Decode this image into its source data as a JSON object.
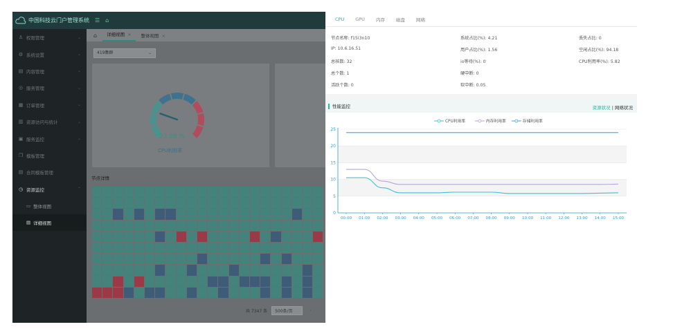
{
  "app": {
    "title": "中国科技云门户管理系统",
    "menu": [
      {
        "label": "权限管理",
        "icon": "user-icon"
      },
      {
        "label": "系统设置",
        "icon": "gear-icon"
      },
      {
        "label": "内容管理",
        "icon": "document-icon"
      },
      {
        "label": "服务管理",
        "icon": "service-icon"
      },
      {
        "label": "订单管理",
        "icon": "order-icon"
      },
      {
        "label": "资源访问与统计",
        "icon": "stats-icon"
      },
      {
        "label": "服务监控",
        "icon": "monitor-icon"
      },
      {
        "label": "模板管理",
        "icon": "template-icon"
      },
      {
        "label": "合同模板管理",
        "icon": "contract-icon"
      },
      {
        "label": "资源监控",
        "icon": "clock-icon"
      }
    ],
    "submenu": [
      {
        "label": "整体视图",
        "icon": "desktop-icon"
      },
      {
        "label": "详细视图",
        "icon": "list-icon"
      }
    ],
    "tabs": [
      {
        "label": "详细视图"
      },
      {
        "label": "整体视图"
      }
    ],
    "cluster_select": "419集群",
    "gauge": {
      "value_text": "23.88 %",
      "label": "CPU利用率",
      "value": 23.88
    },
    "nodes_title": "节点详情",
    "pager": {
      "total": "共 7347 条",
      "page_size": "500条/页"
    }
  },
  "panel": {
    "tabs": [
      "CPU",
      "GPU",
      "内存",
      "磁盘",
      "网络"
    ],
    "info": {
      "node_name": "节点名称: f15i3n10",
      "ip": "IP: 10.6.16.51",
      "total_cores": "总核数: 32",
      "total_count": "总个数: 1",
      "active_count": "活跃个数: 0",
      "sys_ratio": "系统占比(%): 4.21",
      "user_ratio": "用户占比(%): 1.56",
      "io_wait": "io等待(%): 0",
      "hard_irq": "硬中断: 0",
      "soft_irq": "软中断: 0.05",
      "steal_ratio": "丢失占比: 0",
      "idle_ratio": "空闲占比(%): 94.18",
      "cpu_usage": "CPU利用率(%): 5.82"
    },
    "monitor_title": "性能监控",
    "link_resource": "资源状况",
    "link_sep": " | ",
    "link_network": "网络状况"
  },
  "colors": {
    "accent": "#2fb4a4",
    "cpu": "#3cbfd0",
    "mem": "#b8a4d8",
    "disk": "#3fa8c8"
  },
  "chart_data": {
    "type": "line",
    "legend_position": "top-center",
    "x": [
      "00:00",
      "01:00",
      "02:00",
      "03:00",
      "04:00",
      "05:00",
      "06:00",
      "07:00",
      "08:00",
      "09:00",
      "10:00",
      "11:00",
      "12:00",
      "13:00",
      "14:00",
      "15:00"
    ],
    "ylim": [
      0,
      25
    ],
    "yticks": [
      0,
      5,
      10,
      15,
      20,
      25
    ],
    "grid": true,
    "series": [
      {
        "name": "CPU利用率",
        "color": "#3cbfd0",
        "values": [
          10.5,
          10.5,
          7.5,
          6.0,
          6.0,
          6.0,
          6.2,
          6.2,
          6.2,
          5.8,
          5.8,
          5.8,
          5.8,
          5.8,
          5.9,
          6.0
        ]
      },
      {
        "name": "内存利用率",
        "color": "#b8a4d8",
        "values": [
          13.0,
          13.0,
          9.5,
          8.5,
          8.5,
          8.5,
          8.5,
          8.5,
          8.5,
          8.5,
          8.5,
          8.5,
          8.5,
          8.5,
          8.5,
          8.6
        ]
      },
      {
        "name": "存储利用率",
        "color": "#3fa8c8",
        "values": [
          24.0,
          24.0,
          24.0,
          24.0,
          24.0,
          24.0,
          24.0,
          24.0,
          24.0,
          24.0,
          24.0,
          24.0,
          24.0,
          24.0,
          24.0,
          24.0
        ]
      }
    ]
  }
}
